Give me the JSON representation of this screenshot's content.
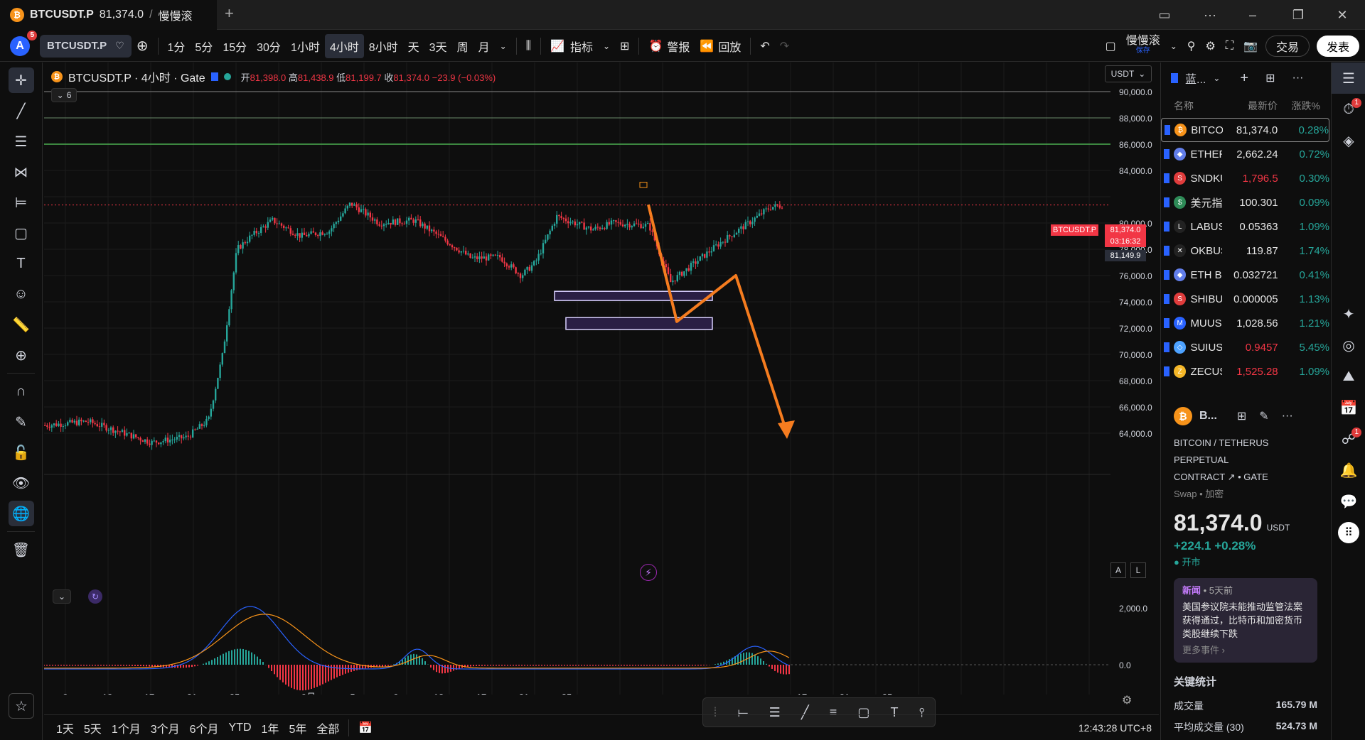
{
  "titlebar": {
    "tab_title": "BTCUSDT.P",
    "tab_price": "81,374.0",
    "tab_sep": "/",
    "tab_name": "慢慢滚",
    "plus": "+"
  },
  "toolbar": {
    "avatar": "A",
    "avatar_badge": "5",
    "symbol": "BTCUSDT.P",
    "intervals": [
      "1分",
      "5分",
      "15分",
      "30分",
      "1小时",
      "4小时",
      "8小时",
      "天",
      "3天",
      "周",
      "月"
    ],
    "active_interval": "4小时",
    "indicators": "指标",
    "alert": "警报",
    "replay": "回放",
    "layout_name": "慢慢滚",
    "layout_sub": "保存",
    "trade": "交易",
    "publish": "发表"
  },
  "legend": {
    "title": "BTCUSDT.P · 4小时 · Gate",
    "open_label": "开",
    "open": "81,398.0",
    "high_label": "高",
    "high": "81,438.9",
    "low_label": "低",
    "low": "81,199.7",
    "close_label": "收",
    "close": "81,374.0",
    "change": "−23.9 (−0.03%)",
    "collapse": "6"
  },
  "price_axis": {
    "currency": "USDT",
    "labels": [
      "90,000.0",
      "88,000.0",
      "86,000.0",
      "84,000.0",
      "80,000.0",
      "78,000.0",
      "76,000.0",
      "74,000.0",
      "72,000.0",
      "70,000.0",
      "68,000.0",
      "66,000.0",
      "64,000.0"
    ],
    "last_price": "81,374.0",
    "countdown": "03:16:32",
    "cross_price": "81,149.9",
    "symbol_tag": "BTCUSDT.P",
    "auto": "A",
    "log": "L"
  },
  "indicator_axis": {
    "labels": [
      "2,000.0",
      "0.0"
    ]
  },
  "time_axis": {
    "labels": [
      "9",
      "13",
      "17",
      "21",
      "25",
      "9月",
      "5",
      "9",
      "13",
      "17",
      "21",
      "25",
      "17",
      "21",
      "25"
    ]
  },
  "colors": {
    "up": "#26a69a",
    "down": "#f23645",
    "orange": "#f7931a",
    "accent": "#2962ff"
  },
  "bottom": {
    "ranges": [
      "1天",
      "5天",
      "1个月",
      "3个月",
      "6个月",
      "YTD",
      "1年",
      "5年",
      "全部"
    ],
    "clock": "12:43:28 UTC+8"
  },
  "watchlist": {
    "title": "蓝...",
    "col_name": "名称",
    "col_price": "最新价",
    "col_change": "涨跌%",
    "rows": [
      {
        "name": "BITCO",
        "price": "81,374.0",
        "change": "0.28%",
        "icon": "₿",
        "color": "#f7931a",
        "price_color": "#e6e6e6"
      },
      {
        "name": "ETHER",
        "price": "2,662.24",
        "change": "0.72%",
        "icon": "◆",
        "color": "#627eea",
        "price_color": "#e6e6e6"
      },
      {
        "name": "SNDKU",
        "price": "1,796.5",
        "change": "0.30%",
        "icon": "S",
        "color": "#e03c3c",
        "price_color": "#f23645"
      },
      {
        "name": "美元指",
        "price": "100.301",
        "change": "0.09%",
        "icon": "$",
        "color": "#2e8b57",
        "price_color": "#e6e6e6"
      },
      {
        "name": "LABUS",
        "price": "0.05363",
        "change": "1.09%",
        "icon": "L",
        "color": "#222",
        "price_color": "#e6e6e6"
      },
      {
        "name": "OKBUS",
        "price": "119.87",
        "change": "1.74%",
        "icon": "✕",
        "color": "#222",
        "price_color": "#e6e6e6"
      },
      {
        "name": "ETH B",
        "price": "0.032721",
        "change": "0.41%",
        "icon": "◆",
        "color": "#627eea",
        "price_color": "#e6e6e6"
      },
      {
        "name": "SHIBU",
        "price": "0.000005",
        "change": "1.13%",
        "icon": "S",
        "color": "#e03c3c",
        "price_color": "#e6e6e6"
      },
      {
        "name": "MUUSI",
        "price": "1,028.56",
        "change": "1.21%",
        "icon": "M",
        "color": "#2962ff",
        "price_color": "#e6e6e6"
      },
      {
        "name": "SUIUSI",
        "price": "0.9457",
        "change": "5.45%",
        "icon": "◇",
        "color": "#4da2ff",
        "price_color": "#f23645"
      },
      {
        "name": "ZECUS",
        "price": "1,525.28",
        "change": "1.09%",
        "icon": "Z",
        "color": "#f4b728",
        "price_color": "#f23645"
      }
    ]
  },
  "details": {
    "short": "B...",
    "full_name_1": "BITCOIN / TETHERUS PERPETUAL",
    "full_name_2": "CONTRACT",
    "exchange": "• GATE",
    "type": "Swap • 加密",
    "price": "81,374.0",
    "currency": "USDT",
    "change_abs": "+224.1",
    "change_pct": "+0.28%",
    "market_status": "开市",
    "news_tag": "新闻",
    "news_time": "• 5天前",
    "news_text": "美国参议院未能推动监管法案获得通过，比特币和加密货币类股继续下跌",
    "news_more": "更多事件 ›",
    "stats_title": "关键统计",
    "volume_label": "成交量",
    "volume": "165.79 M",
    "avg_volume_label": "平均成交量 (30)",
    "avg_volume": "524.73 M"
  }
}
